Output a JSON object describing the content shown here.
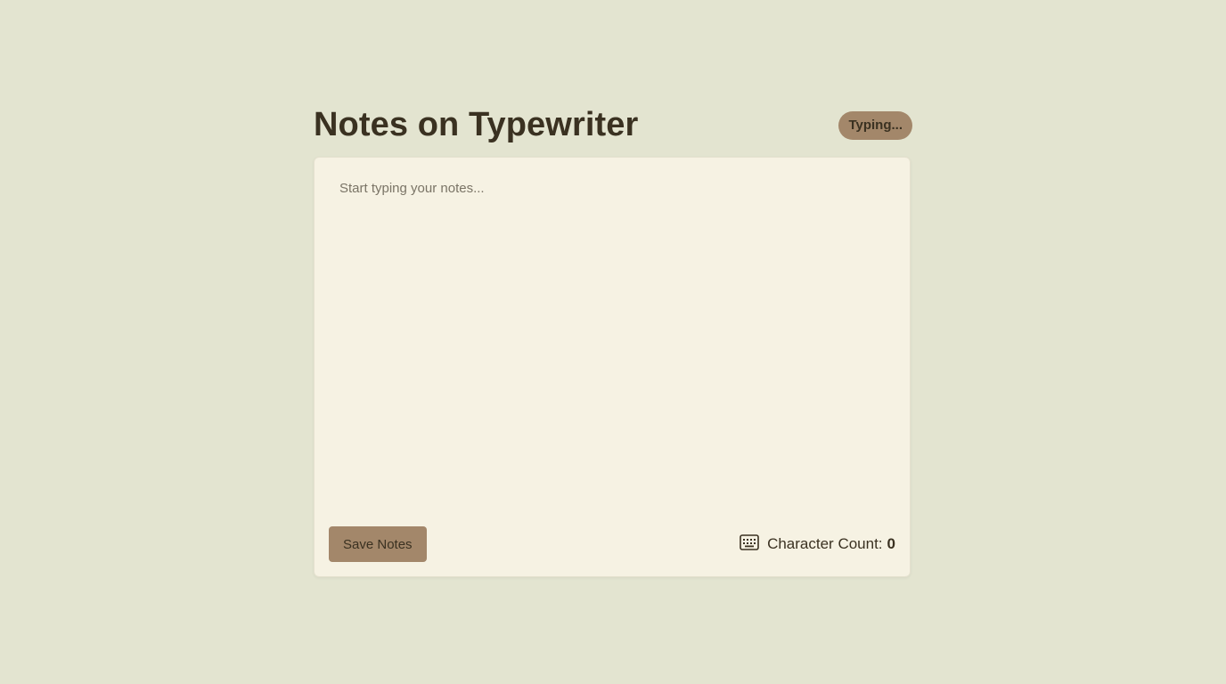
{
  "header": {
    "title": "Notes on Typewriter",
    "status": "Typing..."
  },
  "editor": {
    "placeholder": "Start typing your notes...",
    "value": ""
  },
  "footer": {
    "save_label": "Save Notes",
    "counter_label": "Character Count:",
    "counter_value": "0",
    "counter_icon": "keyboard-icon"
  },
  "colors": {
    "background": "#e3e4d0",
    "card": "#f6f2e3",
    "accent": "#a3876a",
    "text": "#3a3121"
  }
}
